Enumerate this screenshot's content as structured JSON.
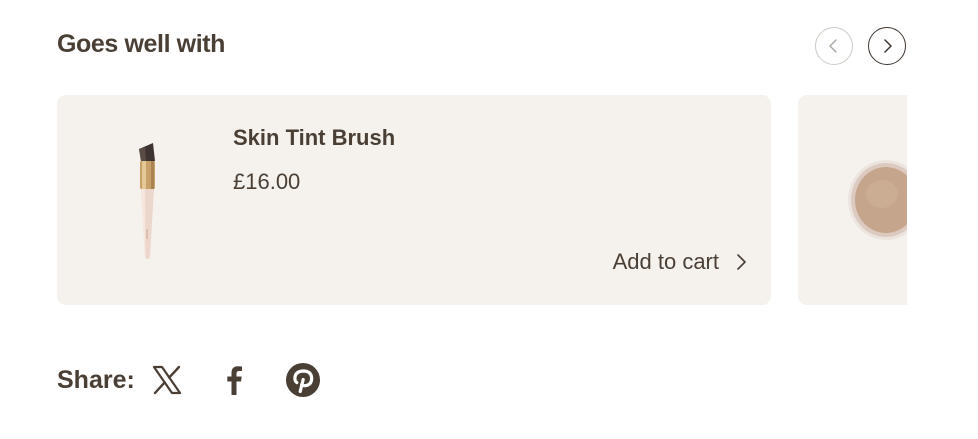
{
  "section": {
    "title": "Goes well with"
  },
  "carousel": {
    "prev_icon": "chevron-left-icon",
    "next_icon": "chevron-right-icon",
    "products": [
      {
        "name": "Skin Tint Brush",
        "price": "£16.00",
        "cta_label": "Add to cart",
        "image": "makeup-brush-image"
      },
      {
        "image": "powder-compact-image"
      }
    ]
  },
  "share": {
    "label": "Share:",
    "networks": [
      "x-icon",
      "facebook-icon",
      "pinterest-icon"
    ]
  },
  "colors": {
    "text": "#4a3f35",
    "card_background": "#f5f2ed",
    "page_background": "#ffffff"
  }
}
